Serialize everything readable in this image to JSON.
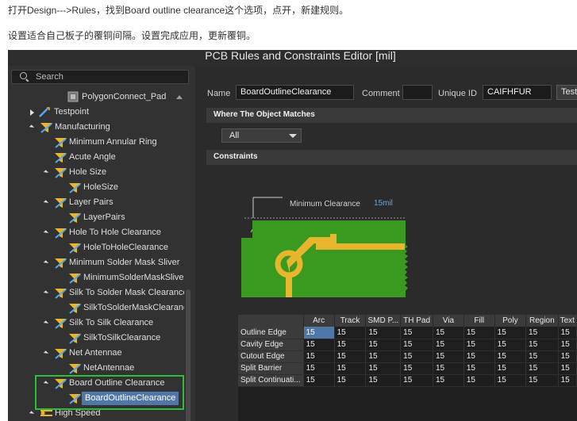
{
  "doc": {
    "line1": "打开Design--->Rules，找到Board outline clearance这个选项，点开，新建规则。",
    "line2": "设置适合自己板子的覆铜间隔。设置完成应用，更新覆铜。"
  },
  "window": {
    "title": "PCB Rules and Constraints Editor [mil]"
  },
  "search": {
    "placeholder": "Search"
  },
  "tree": {
    "items": [
      {
        "label": "PolygonConnect_Pad"
      },
      {
        "label": "Testpoint"
      },
      {
        "label": "Manufacturing"
      },
      {
        "label": "Minimum Annular Ring"
      },
      {
        "label": "Acute Angle"
      },
      {
        "label": "Hole Size"
      },
      {
        "label": "HoleSize"
      },
      {
        "label": "Layer Pairs"
      },
      {
        "label": "LayerPairs"
      },
      {
        "label": "Hole To Hole Clearance"
      },
      {
        "label": "HoleToHoleClearance"
      },
      {
        "label": "Minimum Solder Mask Sliver"
      },
      {
        "label": "MinimumSolderMaskSlive"
      },
      {
        "label": "Silk To Solder Mask Clearance"
      },
      {
        "label": "SilkToSolderMaskClearanc"
      },
      {
        "label": "Silk To Silk Clearance"
      },
      {
        "label": "SilkToSilkClearance"
      },
      {
        "label": "Net Antennae"
      },
      {
        "label": "NetAntennae"
      },
      {
        "label": "Board Outline Clearance"
      },
      {
        "label": "BoardOutlineClearance"
      },
      {
        "label": "High Speed"
      }
    ]
  },
  "editor": {
    "name_label": "Name",
    "name_value": "BoardOutlineClearance",
    "comment_label": "Comment",
    "comment_value": "",
    "uid_label": "Unique ID",
    "uid_value": "CAIFHFUR",
    "test_button": "Test",
    "where_header": "Where The Object Matches",
    "match_value": "All",
    "constraints_header": "Constraints",
    "min_clearance_label": "Minimum Clearance",
    "min_clearance_value": "15mil"
  },
  "grid": {
    "columns": [
      "Arc",
      "Track",
      "SMD P...",
      "TH Pad",
      "Via",
      "Fill",
      "Poly",
      "Region",
      "Text"
    ],
    "rows": [
      {
        "name": "Outline Edge",
        "values": [
          "15",
          "15",
          "15",
          "15",
          "15",
          "15",
          "15",
          "15",
          "15"
        ]
      },
      {
        "name": "Cavity Edge",
        "values": [
          "15",
          "15",
          "15",
          "15",
          "15",
          "15",
          "15",
          "15",
          "15"
        ]
      },
      {
        "name": "Cutout Edge",
        "values": [
          "15",
          "15",
          "15",
          "15",
          "15",
          "15",
          "15",
          "15",
          "15"
        ]
      },
      {
        "name": "Split Barrier",
        "values": [
          "15",
          "15",
          "15",
          "15",
          "15",
          "15",
          "15",
          "15",
          "15"
        ]
      },
      {
        "name": "Split Continuati...",
        "values": [
          "15",
          "15",
          "15",
          "15",
          "15",
          "15",
          "15",
          "15",
          "15"
        ]
      }
    ]
  },
  "colors": {
    "selection": "#4f77a8",
    "highlight_border": "#2dbd3a",
    "board_green": "#3a9a1f",
    "track_yellow": "#e8b62c",
    "accent_blue": "#5aa8e8"
  }
}
